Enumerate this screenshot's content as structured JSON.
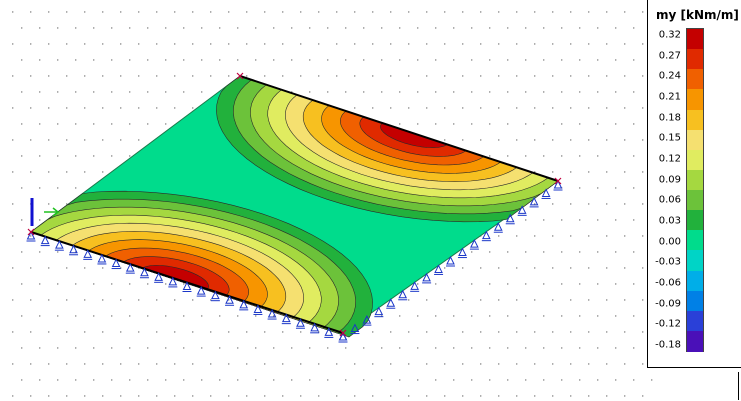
{
  "legend": {
    "title": "my [kNm/m]",
    "labels": [
      "0.32",
      "0.27",
      "0.24",
      "0.21",
      "0.18",
      "0.15",
      "0.12",
      "0.09",
      "0.06",
      "0.03",
      "0.00",
      "-0.03",
      "-0.06",
      "-0.09",
      "-0.12",
      "-0.18"
    ],
    "colors": [
      "#c40000",
      "#e02a00",
      "#f06000",
      "#f79500",
      "#f7c020",
      "#f5e070",
      "#e0ec60",
      "#a5d840",
      "#6cc23a",
      "#22b13c",
      "#00dc8c",
      "#00d4c6",
      "#00aee8",
      "#0080e6",
      "#2a40d8",
      "#4a10b8"
    ]
  },
  "scene": {
    "plate_color": "#00dc8c",
    "contour_colors": [
      "#22b13c",
      "#6cc23a",
      "#a5d840",
      "#e0ec60",
      "#f5e070",
      "#f7c020",
      "#f79500",
      "#f06000",
      "#e02a00",
      "#c40000"
    ],
    "support_color": "#1a36c8"
  }
}
